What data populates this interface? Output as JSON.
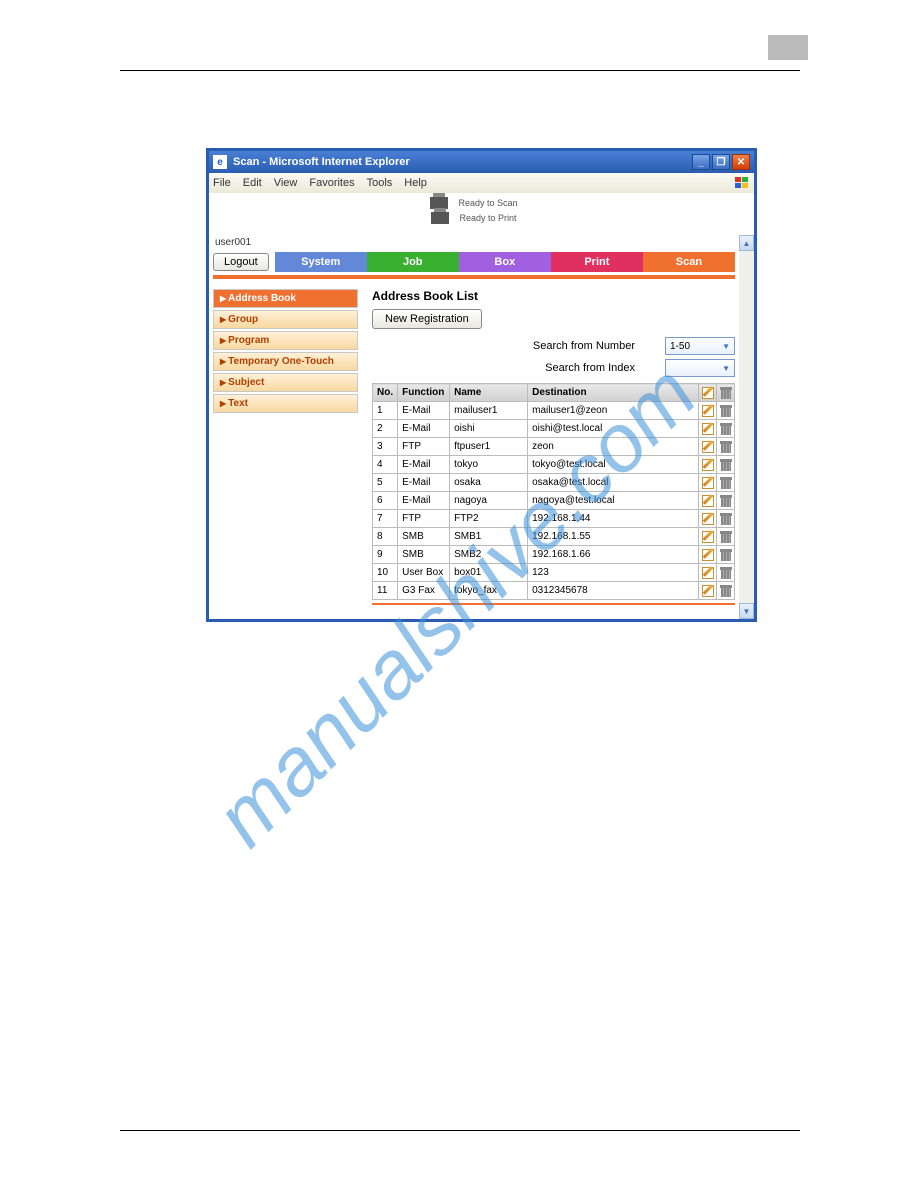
{
  "window": {
    "title": "Scan - Microsoft Internet Explorer"
  },
  "menu": {
    "file": "File",
    "edit": "Edit",
    "view": "View",
    "favorites": "Favorites",
    "tools": "Tools",
    "help": "Help"
  },
  "status": {
    "scan": "Ready to Scan",
    "print": "Ready to Print"
  },
  "user": "user001",
  "logout": "Logout",
  "tabs": {
    "system": "System",
    "job": "Job",
    "box": "Box",
    "print": "Print",
    "scan": "Scan"
  },
  "sidebar": {
    "items": [
      {
        "label": "Address Book"
      },
      {
        "label": "Group"
      },
      {
        "label": "Program"
      },
      {
        "label": "Temporary One-Touch"
      },
      {
        "label": "Subject"
      },
      {
        "label": "Text"
      }
    ]
  },
  "main": {
    "heading": "Address Book List",
    "new_reg": "New Registration",
    "search_number_label": "Search from Number",
    "search_number_value": "1-50",
    "search_index_label": "Search from Index",
    "headers": {
      "no": "No.",
      "function": "Function",
      "name": "Name",
      "destination": "Destination"
    },
    "rows": [
      {
        "no": "1",
        "fn": "E-Mail",
        "name": "mailuser1",
        "dest": "mailuser1@zeon"
      },
      {
        "no": "2",
        "fn": "E-Mail",
        "name": "oishi",
        "dest": "oishi@test.local"
      },
      {
        "no": "3",
        "fn": "FTP",
        "name": "ftpuser1",
        "dest": "zeon"
      },
      {
        "no": "4",
        "fn": "E-Mail",
        "name": "tokyo",
        "dest": "tokyo@test.local"
      },
      {
        "no": "5",
        "fn": "E-Mail",
        "name": "osaka",
        "dest": "osaka@test.local"
      },
      {
        "no": "6",
        "fn": "E-Mail",
        "name": "nagoya",
        "dest": "nagoya@test.local"
      },
      {
        "no": "7",
        "fn": "FTP",
        "name": "FTP2",
        "dest": "192.168.1.44"
      },
      {
        "no": "8",
        "fn": "SMB",
        "name": "SMB1",
        "dest": "192.168.1.55"
      },
      {
        "no": "9",
        "fn": "SMB",
        "name": "SMB2",
        "dest": "192.168.1.66"
      },
      {
        "no": "10",
        "fn": "User Box",
        "name": "box01",
        "dest": "123"
      },
      {
        "no": "11",
        "fn": "G3 Fax",
        "name": "tokyo_fax",
        "dest": "0312345678"
      }
    ]
  },
  "watermark": "manualshive.com"
}
